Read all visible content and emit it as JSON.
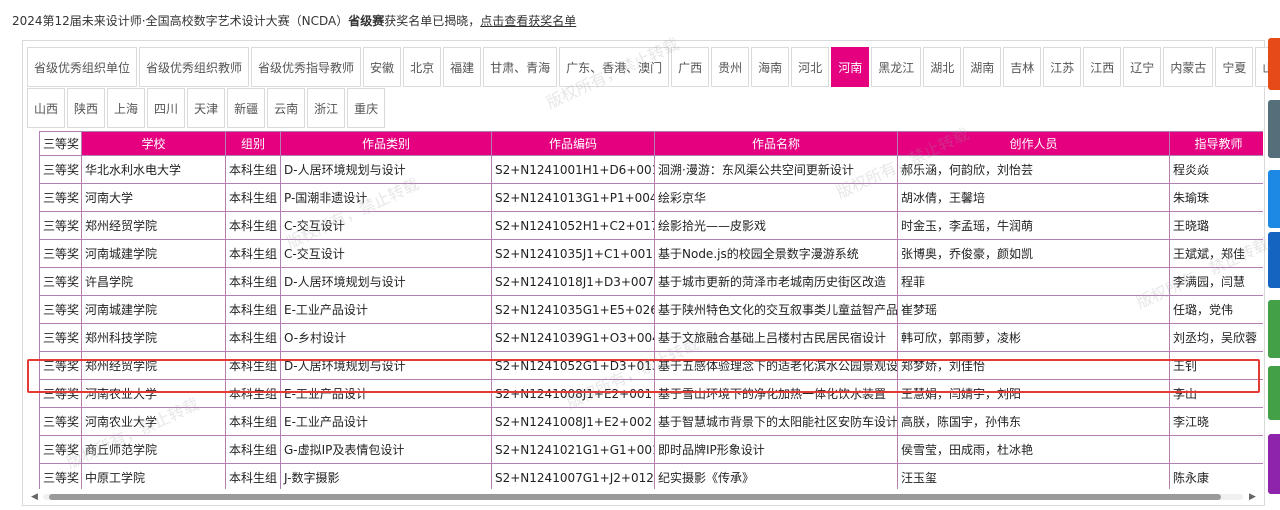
{
  "notice": {
    "prefix": "2024第12届未来设计师·全国高校数字艺术设计大赛（NCDA）",
    "bold": "省级赛",
    "middle": "获奖名单已揭晓，",
    "link": "点击查看获奖名单"
  },
  "tabs_row1": [
    "省级优秀组织单位",
    "省级优秀组织教师",
    "省级优秀指导教师",
    "安徽",
    "北京",
    "福建",
    "甘肃、青海",
    "广东、香港、澳门",
    "广西",
    "贵州",
    "海南",
    "河北",
    "河南",
    "黑龙江",
    "湖北",
    "湖南",
    "吉林",
    "江苏",
    "江西",
    "辽宁",
    "内蒙古",
    "宁夏",
    "山东"
  ],
  "tabs_row2": [
    "山西",
    "陕西",
    "上海",
    "四川",
    "天津",
    "新疆",
    "云南",
    "浙江",
    "重庆"
  ],
  "active_tab": "河南",
  "table": {
    "award_col_top": "三等奖",
    "headers": [
      "学校",
      "组别",
      "作品类别",
      "作品编码",
      "作品名称",
      "创作人员",
      "指导教师"
    ],
    "rows": [
      [
        "三等奖",
        "华北水利水电大学",
        "本科生组",
        "D-人居环境规划与设计",
        "S2+N1241001H1+D6+001",
        "洄溯·漫游：东风渠公共空间更新设计",
        "郝乐涵，何韵欣，刘怡芸",
        "程炎焱"
      ],
      [
        "三等奖",
        "河南大学",
        "本科生组",
        "P-国潮非遗设计",
        "S2+N1241013G1+P1+004",
        "绘彩京华",
        "胡冰倩，王馨培",
        "朱瑜珠"
      ],
      [
        "三等奖",
        "郑州经贸学院",
        "本科生组",
        "C-交互设计",
        "S2+N1241052H1+C2+017",
        "绘影拾光——皮影戏",
        "时金玉，李孟瑶，牛润萌",
        "王晓璐"
      ],
      [
        "三等奖",
        "河南城建学院",
        "本科生组",
        "C-交互设计",
        "S2+N1241035J1+C1+001",
        "基于Node.js的校园全景数字漫游系统",
        "张博奥，乔俊豪，颜如凯",
        "王斌斌，郑佳"
      ],
      [
        "三等奖",
        "许昌学院",
        "本科生组",
        "D-人居环境规划与设计",
        "S2+N1241018J1+D3+007",
        "基于城市更新的菏泽市老城南历史街区改造",
        "程菲",
        "李满园，闫慧"
      ],
      [
        "三等奖",
        "河南城建学院",
        "本科生组",
        "E-工业产品设计",
        "S2+N1241035G1+E5+026",
        "基于陕州特色文化的交互叙事类儿童益智产品",
        "崔梦瑶",
        "任璐，党伟"
      ],
      [
        "三等奖",
        "郑州科技学院",
        "本科生组",
        "O-乡村设计",
        "S2+N1241039G1+O3+004",
        "基于文旅融合基础上吕楼村古民居民宿设计",
        "韩可欣，郭雨萝，凌彬",
        "刘丞均，吴欣蓉"
      ],
      [
        "三等奖",
        "郑州经贸学院",
        "本科生组",
        "D-人居环境规划与设计",
        "S2+N1241052G1+D3+013",
        "基于五感体验理念下的适老化滨水公园景观设",
        "郑梦娇，刘佳怡",
        "王钊"
      ],
      [
        "三等奖",
        "河南农业大学",
        "本科生组",
        "E-工业产品设计",
        "S2+N1241008J1+E2+001",
        "基于雪山环境下的净化加热一体化饮水装置",
        "王慧娟，闫婧宇，刘阳",
        "李山"
      ],
      [
        "三等奖",
        "河南农业大学",
        "本科生组",
        "E-工业产品设计",
        "S2+N1241008J1+E2+002",
        "基于智慧城市背景下的太阳能社区安防车设计",
        "高朕，陈国宇，孙伟东",
        "李江晓"
      ],
      [
        "三等奖",
        "商丘师范学院",
        "本科生组",
        "G-虚拟IP及表情包设计",
        "S2+N1241021G1+G1+001",
        "即时品牌IP形象设计",
        "侯雪莹，田成雨，杜冰艳",
        ""
      ],
      [
        "三等奖",
        "中原工学院",
        "本科生组",
        "J-数字摄影",
        "S2+N1241007G1+J2+012",
        "纪实摄影《传承》",
        "汪玉玺",
        "陈永康"
      ]
    ]
  },
  "watermark_text": "版权所有，禁止转载",
  "side_colors": [
    "#e64a19",
    "#546e7a",
    "#1e88e5",
    "#1565c0",
    "#43a047",
    "#43a047",
    "#8e24aa"
  ],
  "colors": {
    "accent": "#e4007f",
    "highlight": "#e53935"
  }
}
